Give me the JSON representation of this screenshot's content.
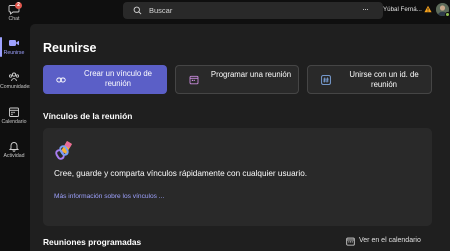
{
  "rail": {
    "items": [
      {
        "label": "Chat",
        "badge": "2"
      },
      {
        "label": "Reunirse"
      },
      {
        "label": "Comunidades"
      },
      {
        "label": "Calendario"
      },
      {
        "label": "Actividad"
      }
    ],
    "active_color": "#9ea2ff"
  },
  "topbar": {
    "search_placeholder": "Buscar",
    "more_label": "···",
    "user_name": "Yúbal Ferná..."
  },
  "main": {
    "title": "Reunirse",
    "actions": [
      {
        "label": "Crear un vínculo de reunión",
        "icon": "link-icon"
      },
      {
        "label": "Programar una reunión",
        "icon": "calendar-icon"
      },
      {
        "label": "Unirse con un id. de reunión",
        "icon": "hash-icon"
      }
    ],
    "links_section": {
      "title": "Vínculos de la reunión",
      "headline": "Cree, guarde y comparta vínculos rápidamente con cualquier usuario.",
      "more_link": "Más información sobre los vínculos ..."
    },
    "scheduled_section": {
      "title": "Reuniones programadas",
      "calendar_link": "Ver en el calendario"
    }
  },
  "colors": {
    "accent": "#5b5fc7",
    "link": "#9ea2ff",
    "background": "#0f0f0f",
    "panel": "#1f1f1f",
    "card": "#292929"
  }
}
